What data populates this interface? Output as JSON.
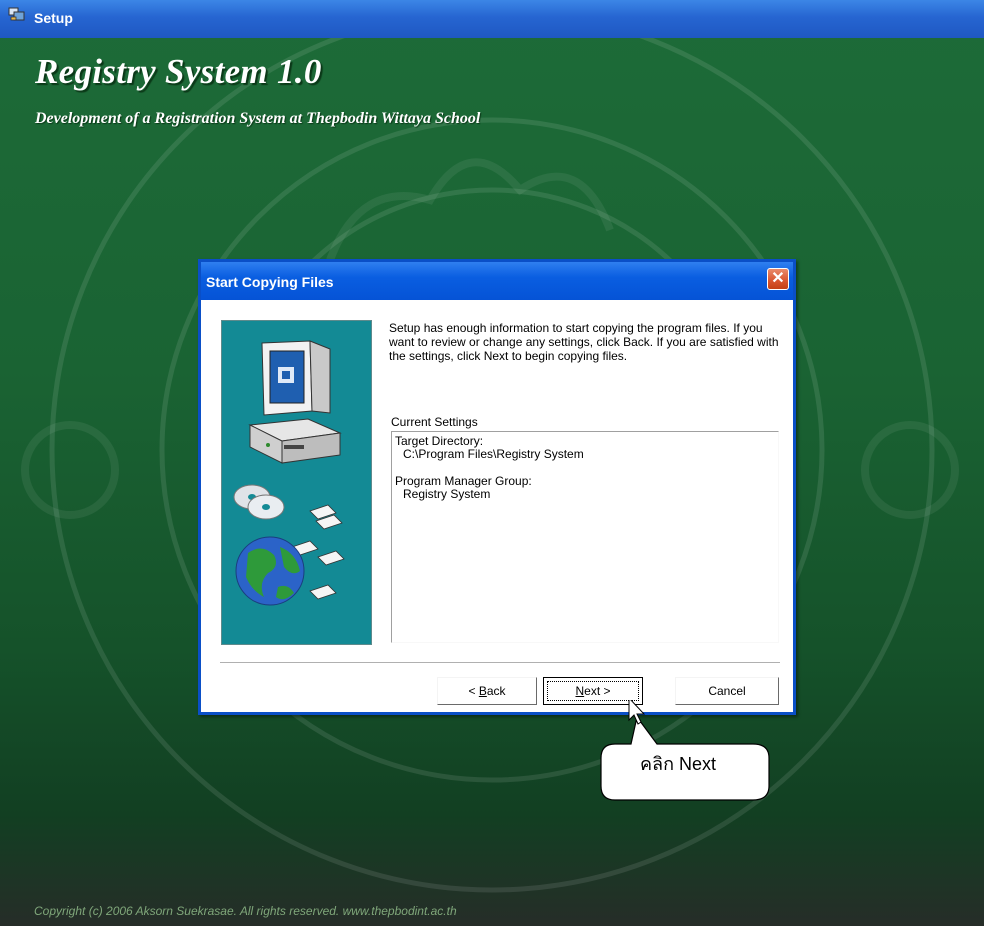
{
  "window": {
    "title": "Setup",
    "icon": "setup-installer-icon"
  },
  "banner": {
    "title": "Registry System 1.0",
    "subtitle": "Development of a Registration System at  Thepbodin Wittaya School"
  },
  "dialog": {
    "title": "Start Copying Files",
    "intro": "Setup has enough information to start copying the program files. If you want to review or change any settings, click Back. If you are satisfied with the settings, click Next to begin copying files.",
    "settings_label": "Current Settings",
    "settings": {
      "target_label": "Target Directory:",
      "target_value": "C:\\Program Files\\Registry System",
      "group_label": "Program Manager Group:",
      "group_value": "Registry System"
    },
    "buttons": {
      "back_prefix": "< ",
      "back_key": "B",
      "back_rest": "ack",
      "next_key": "N",
      "next_rest": "ext >",
      "cancel": "Cancel"
    },
    "close_glyph": "✕"
  },
  "callout": {
    "text": "คลิก Next"
  },
  "footer": {
    "copyright": "Copyright (c) 2006 Aksorn Suekrasae. All rights reserved. www.thepbodint.ac.th"
  },
  "colors": {
    "background_green": "#1a6333",
    "titlebar_blue": "#2665d1",
    "dialog_border": "#0a4fc7",
    "side_panel_teal": "#138a95",
    "close_red": "#d8542e"
  }
}
